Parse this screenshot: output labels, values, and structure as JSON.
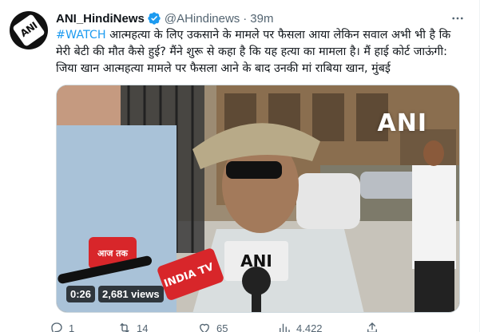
{
  "tweet": {
    "name": "ANI_HindiNews",
    "handle": "@AHindinews",
    "separator": "·",
    "time": "39m",
    "hashtag": "#WATCH",
    "body": " आत्महत्या के लिए उकसाने के मामले पर फैसला आया लेकिन सवाल अभी भी है कि मेरी बेटी की मौत कैसे हुई? मैंने शुरू से कहा है कि यह हत्या का मामला है। मैं हाई कोर्ट जाऊंगी: जिया खान आत्महत्या मामले पर फैसला आने के बाद उनकी मां राबिया खान, मुंबई",
    "avatar_text": "ANI",
    "accent_color": "#1d9bf0"
  },
  "media": {
    "watermark": "ANI",
    "duration": "0:26",
    "views": "2,681 views",
    "mic_labels": [
      "ANI",
      "INDIA TV",
      "आज तक"
    ]
  },
  "actions": {
    "reply_count": "1",
    "retweet_count": "14",
    "like_count": "65",
    "view_count": "4,422"
  }
}
